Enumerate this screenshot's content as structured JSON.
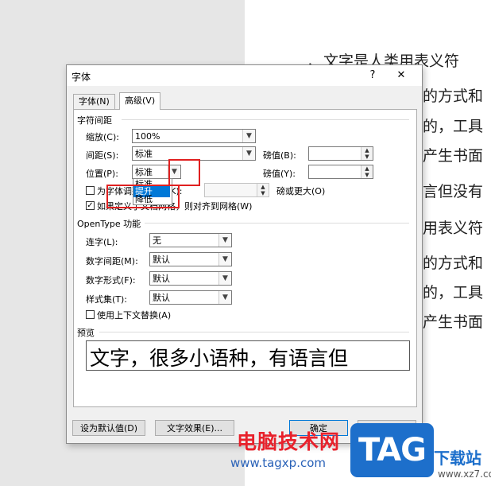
{
  "document": {
    "lines": [
      "、文字是人类用表义符",
      "的方式和",
      "的，工具",
      "产生书面",
      "言但没有",
      "用表义符",
      "的方式和",
      "的，工具",
      "产生书面"
    ]
  },
  "dialog": {
    "title": "字体",
    "help_label": "?",
    "close_label": "✕",
    "tabs": [
      {
        "label": "字体(N)"
      },
      {
        "label": "高级(V)"
      }
    ],
    "char_spacing": {
      "heading": "字符间距",
      "scale_label": "缩放(C):",
      "scale_value": "100%",
      "spacing_label": "间距(S):",
      "spacing_value": "标准",
      "spacing_by_label": "磅值(B):",
      "position_label": "位置(P):",
      "position_value": "标准",
      "position_by_label": "磅值(Y):",
      "kerning_label": "为字体调整字间距(K):",
      "kerning_suffix": "磅或更大(O)",
      "grid_label": "如果定义了文档网格，则对齐到网格(W)",
      "position_options": [
        "标准",
        "提升",
        "降低"
      ]
    },
    "opentype": {
      "heading": "OpenType 功能",
      "ligature_label": "连字(L):",
      "ligature_value": "无",
      "num_spacing_label": "数字间距(M):",
      "num_spacing_value": "默认",
      "num_form_label": "数字形式(F):",
      "num_form_value": "默认",
      "style_set_label": "样式集(T):",
      "style_set_value": "默认",
      "contextual_label": "使用上下文替换(A)"
    },
    "preview": {
      "heading": "预览",
      "text": "文字，很多小语种，有语言但"
    },
    "buttons": {
      "set_default": "设为默认值(D)",
      "text_effects": "文字效果(E)...",
      "ok": "确定",
      "cancel": "取消"
    }
  },
  "watermark": {
    "site_name": "电脑技术网",
    "site_url": "www.tagxp.com",
    "logo_text": "TAG",
    "xz_name": "下载站",
    "xz_url": "www.xz7.com"
  },
  "colors": {
    "highlight_red": "#e02020",
    "selection_blue": "#0078d7",
    "logo_blue": "#1d6fcb",
    "watermark_red": "#e8212b"
  }
}
